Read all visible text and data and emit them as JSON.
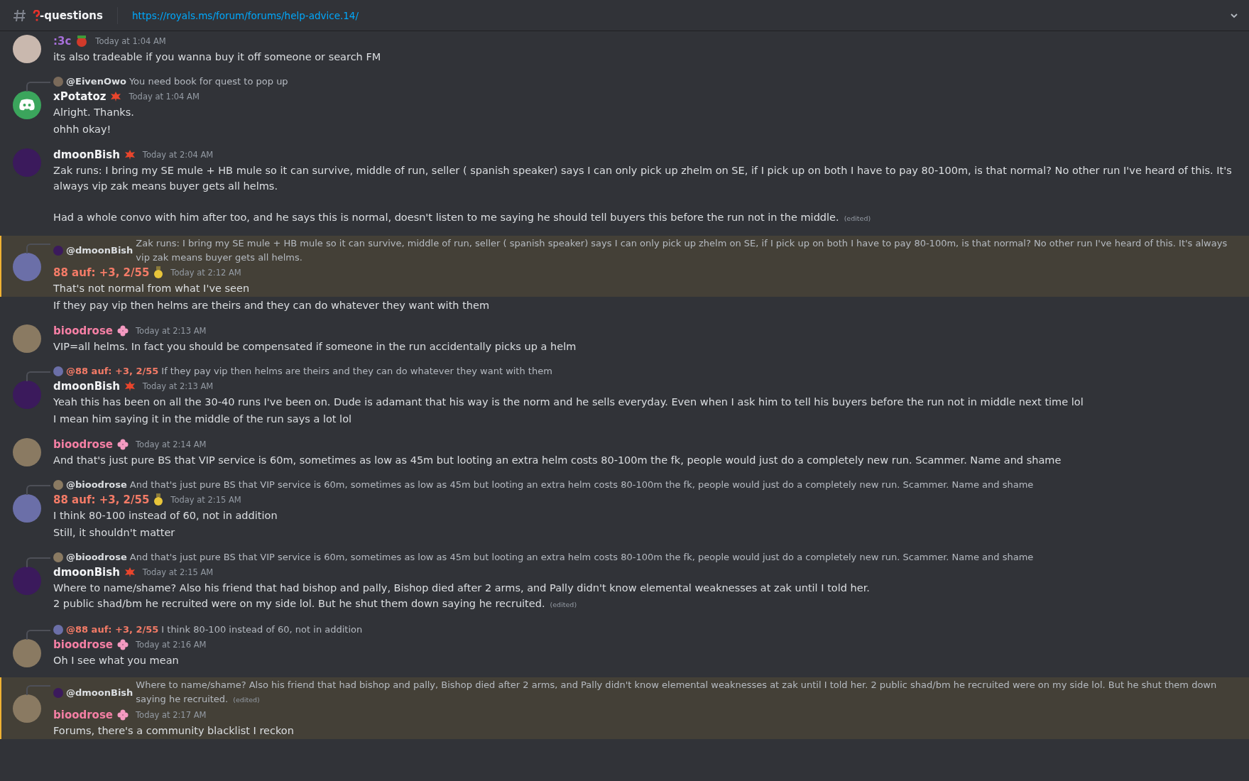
{
  "header": {
    "channel_name": "-questions",
    "topic_link": "https://royals.ms/forum/forums/help-advice.14/"
  },
  "groups": [
    {
      "author": {
        "name": ":3c",
        "color": "#a66fd9"
      },
      "avatar": {
        "kind": "photo",
        "color": "#c9b8ae"
      },
      "badge": {
        "kind": "ornament"
      },
      "time": "Today at 1:04 AM",
      "lines": [
        {
          "text": "its also tradeable if you wanna buy it off someone or search FM",
          "mentioned": false
        }
      ]
    },
    {
      "reply": {
        "author": {
          "name": "@EivenOwo",
          "color": "#dbdee1"
        },
        "avatar": {
          "color": "#7a6a5a"
        },
        "text": "You need book for quest to pop up"
      },
      "author": {
        "name": "xPotatoz",
        "color": "#f2f3f5"
      },
      "avatar": {
        "kind": "discord",
        "color": "#3ba55c"
      },
      "badge": {
        "kind": "leaf"
      },
      "time": "Today at 1:04 AM",
      "lines": [
        {
          "text": "Alright. Thanks.",
          "mentioned": false
        },
        {
          "text": "ohhh okay!",
          "mentioned": false
        }
      ]
    },
    {
      "author": {
        "name": "dmoonBish",
        "color": "#f2f3f5"
      },
      "avatar": {
        "kind": "photo",
        "color": "#3b1a5c"
      },
      "badge": {
        "kind": "leaf"
      },
      "time": "Today at 2:04 AM",
      "lines": [
        {
          "text": "Zak runs: I bring my SE mule + HB mule so it can survive, middle of run, seller ( spanish speaker) says I can only pick up zhelm on SE, if I pick up on both I have to pay 80-100m, is that normal? No other run I've heard of this. It's always vip zak means buyer gets all helms.\n\nHad a whole convo with him after too, and he says this is normal, doesn't listen to me saying he should tell buyers this before the run not in the middle.",
          "edited": "(edited)",
          "mentioned": false
        }
      ]
    },
    {
      "reply": {
        "author": {
          "name": "@dmoonBish",
          "color": "#dbdee1"
        },
        "avatar": {
          "color": "#3b1a5c"
        },
        "text": "Zak runs: I bring my SE mule + HB mule so it can survive, middle of run, seller ( spanish speaker) says I can only pick up zhelm on SE, if I pick up on both I have to pay 80-100m, is that normal? No other run I've heard of this. It's always vip zak means buyer gets all helms."
      },
      "author": {
        "name": "88 auf: +3, 2/55",
        "color": "#f47b67"
      },
      "avatar": {
        "kind": "photo",
        "color": "#6b6fa8"
      },
      "badge": {
        "kind": "medal"
      },
      "time": "Today at 2:12 AM",
      "lines": [
        {
          "text": "That's not normal from what I've seen",
          "mentioned": true
        },
        {
          "text": "If they pay vip then helms are theirs and they can do whatever they want with them",
          "mentioned": false
        }
      ]
    },
    {
      "author": {
        "name": "bioodrose",
        "color": "#f47fa4"
      },
      "avatar": {
        "kind": "photo",
        "color": "#8a7a62"
      },
      "badge": {
        "kind": "flower"
      },
      "time": "Today at 2:13 AM",
      "lines": [
        {
          "text": "VIP=all helms. In fact you should be compensated if someone in the run accidentally picks up a helm",
          "mentioned": false
        }
      ]
    },
    {
      "reply": {
        "author": {
          "name": "@88 auf: +3, 2/55",
          "color": "#f47b67"
        },
        "avatar": {
          "color": "#6b6fa8"
        },
        "text": "If they pay vip then helms are theirs and they can do whatever they want with them"
      },
      "author": {
        "name": "dmoonBish",
        "color": "#f2f3f5"
      },
      "avatar": {
        "kind": "photo",
        "color": "#3b1a5c"
      },
      "badge": {
        "kind": "leaf"
      },
      "time": "Today at 2:13 AM",
      "lines": [
        {
          "text": "Yeah this has been on all the 30-40 runs I've been on. Dude is adamant that his way is the norm and he sells everyday. Even when I ask him to tell his buyers before the run not in middle next time lol",
          "mentioned": false
        },
        {
          "text": "I mean him saying it in the middle of the run says a lot lol",
          "mentioned": false
        }
      ]
    },
    {
      "author": {
        "name": "bioodrose",
        "color": "#f47fa4"
      },
      "avatar": {
        "kind": "photo",
        "color": "#8a7a62"
      },
      "badge": {
        "kind": "flower"
      },
      "time": "Today at 2:14 AM",
      "lines": [
        {
          "text": "And that's just pure BS that VIP service is 60m, sometimes as low as 45m but looting an extra helm costs 80-100m the fk, people would just do a completely new run. Scammer. Name and shame",
          "mentioned": false
        }
      ]
    },
    {
      "reply": {
        "author": {
          "name": "@bioodrose",
          "color": "#dbdee1"
        },
        "avatar": {
          "color": "#8a7a62"
        },
        "text": "And that's just pure BS that VIP service is 60m, sometimes as low as 45m but looting an extra helm costs 80-100m the fk, people would just do a completely new run. Scammer. Name and shame"
      },
      "author": {
        "name": "88 auf: +3, 2/55",
        "color": "#f47b67"
      },
      "avatar": {
        "kind": "photo",
        "color": "#6b6fa8"
      },
      "badge": {
        "kind": "medal"
      },
      "time": "Today at 2:15 AM",
      "lines": [
        {
          "text": "I think 80-100 instead of 60, not in addition",
          "mentioned": false
        },
        {
          "text": "Still, it shouldn't matter",
          "mentioned": false
        }
      ]
    },
    {
      "reply": {
        "author": {
          "name": "@bioodrose",
          "color": "#dbdee1"
        },
        "avatar": {
          "color": "#8a7a62"
        },
        "text": "And that's just pure BS that VIP service is 60m, sometimes as low as 45m but looting an extra helm costs 80-100m the fk, people would just do a completely new run. Scammer. Name and shame"
      },
      "author": {
        "name": "dmoonBish",
        "color": "#f2f3f5"
      },
      "avatar": {
        "kind": "photo",
        "color": "#3b1a5c"
      },
      "badge": {
        "kind": "leaf"
      },
      "time": "Today at 2:15 AM",
      "lines": [
        {
          "text": "Where to name/shame? Also his friend that had bishop and pally, Bishop died after 2 arms, and Pally didn't know elemental weaknesses at zak until I told her.\n2 public shad/bm he recruited were on my side lol. But he shut them down saying he recruited.",
          "edited": "(edited)",
          "mentioned": false
        }
      ]
    },
    {
      "reply": {
        "author": {
          "name": "@88 auf: +3, 2/55",
          "color": "#f47b67"
        },
        "avatar": {
          "color": "#6b6fa8"
        },
        "text": "I think 80-100 instead of 60, not in addition"
      },
      "author": {
        "name": "bioodrose",
        "color": "#f47fa4"
      },
      "avatar": {
        "kind": "photo",
        "color": "#8a7a62"
      },
      "badge": {
        "kind": "flower"
      },
      "time": "Today at 2:16 AM",
      "lines": [
        {
          "text": "Oh I see what you mean",
          "mentioned": false
        }
      ]
    },
    {
      "reply": {
        "author": {
          "name": "@dmoonBish",
          "color": "#dbdee1"
        },
        "avatar": {
          "color": "#3b1a5c"
        },
        "text": "Where to name/shame? Also his friend that had bishop and pally, Bishop died after 2 arms, and Pally didn't know elemental weaknesses at zak until I told her. 2 public shad/bm he recruited were on my side lol. But he shut them down saying he recruited.",
        "edited": "(edited)"
      },
      "author": {
        "name": "bioodrose",
        "color": "#f47fa4"
      },
      "avatar": {
        "kind": "photo",
        "color": "#8a7a62"
      },
      "badge": {
        "kind": "flower"
      },
      "time": "Today at 2:17 AM",
      "lines": [
        {
          "text": "Forums, there's a community blacklist I reckon",
          "mentioned": true
        }
      ]
    }
  ]
}
